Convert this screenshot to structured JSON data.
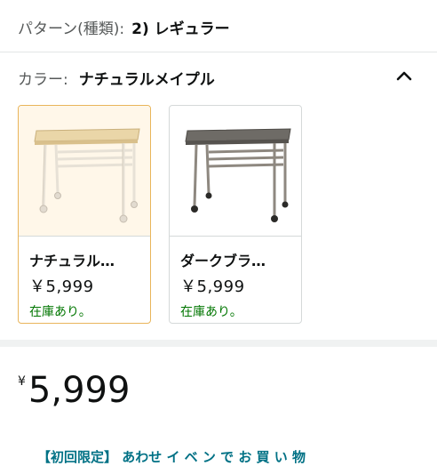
{
  "pattern": {
    "label": "パターン(種類):",
    "value": "2) レギュラー"
  },
  "color": {
    "label": "カラー:",
    "value": "ナチュラルメイプル",
    "toggle_icon": "chevron-up-icon"
  },
  "options": [
    {
      "name": "ナチュラル…",
      "price": "￥5,999",
      "stock": "在庫あり。",
      "selected": true
    },
    {
      "name": "ダークブラ…",
      "price": "￥5,999",
      "stock": "在庫あり。",
      "selected": false
    }
  ],
  "price": {
    "symbol": "¥",
    "amount": "5,999"
  },
  "promo": {
    "text": "【初回限定】 あわせ イ ベ ン で お 買 い 物"
  },
  "colors": {
    "selected_border": "#e9b55b",
    "selected_bg": "#fff7e9",
    "stock": "#007600",
    "link": "#007185"
  }
}
